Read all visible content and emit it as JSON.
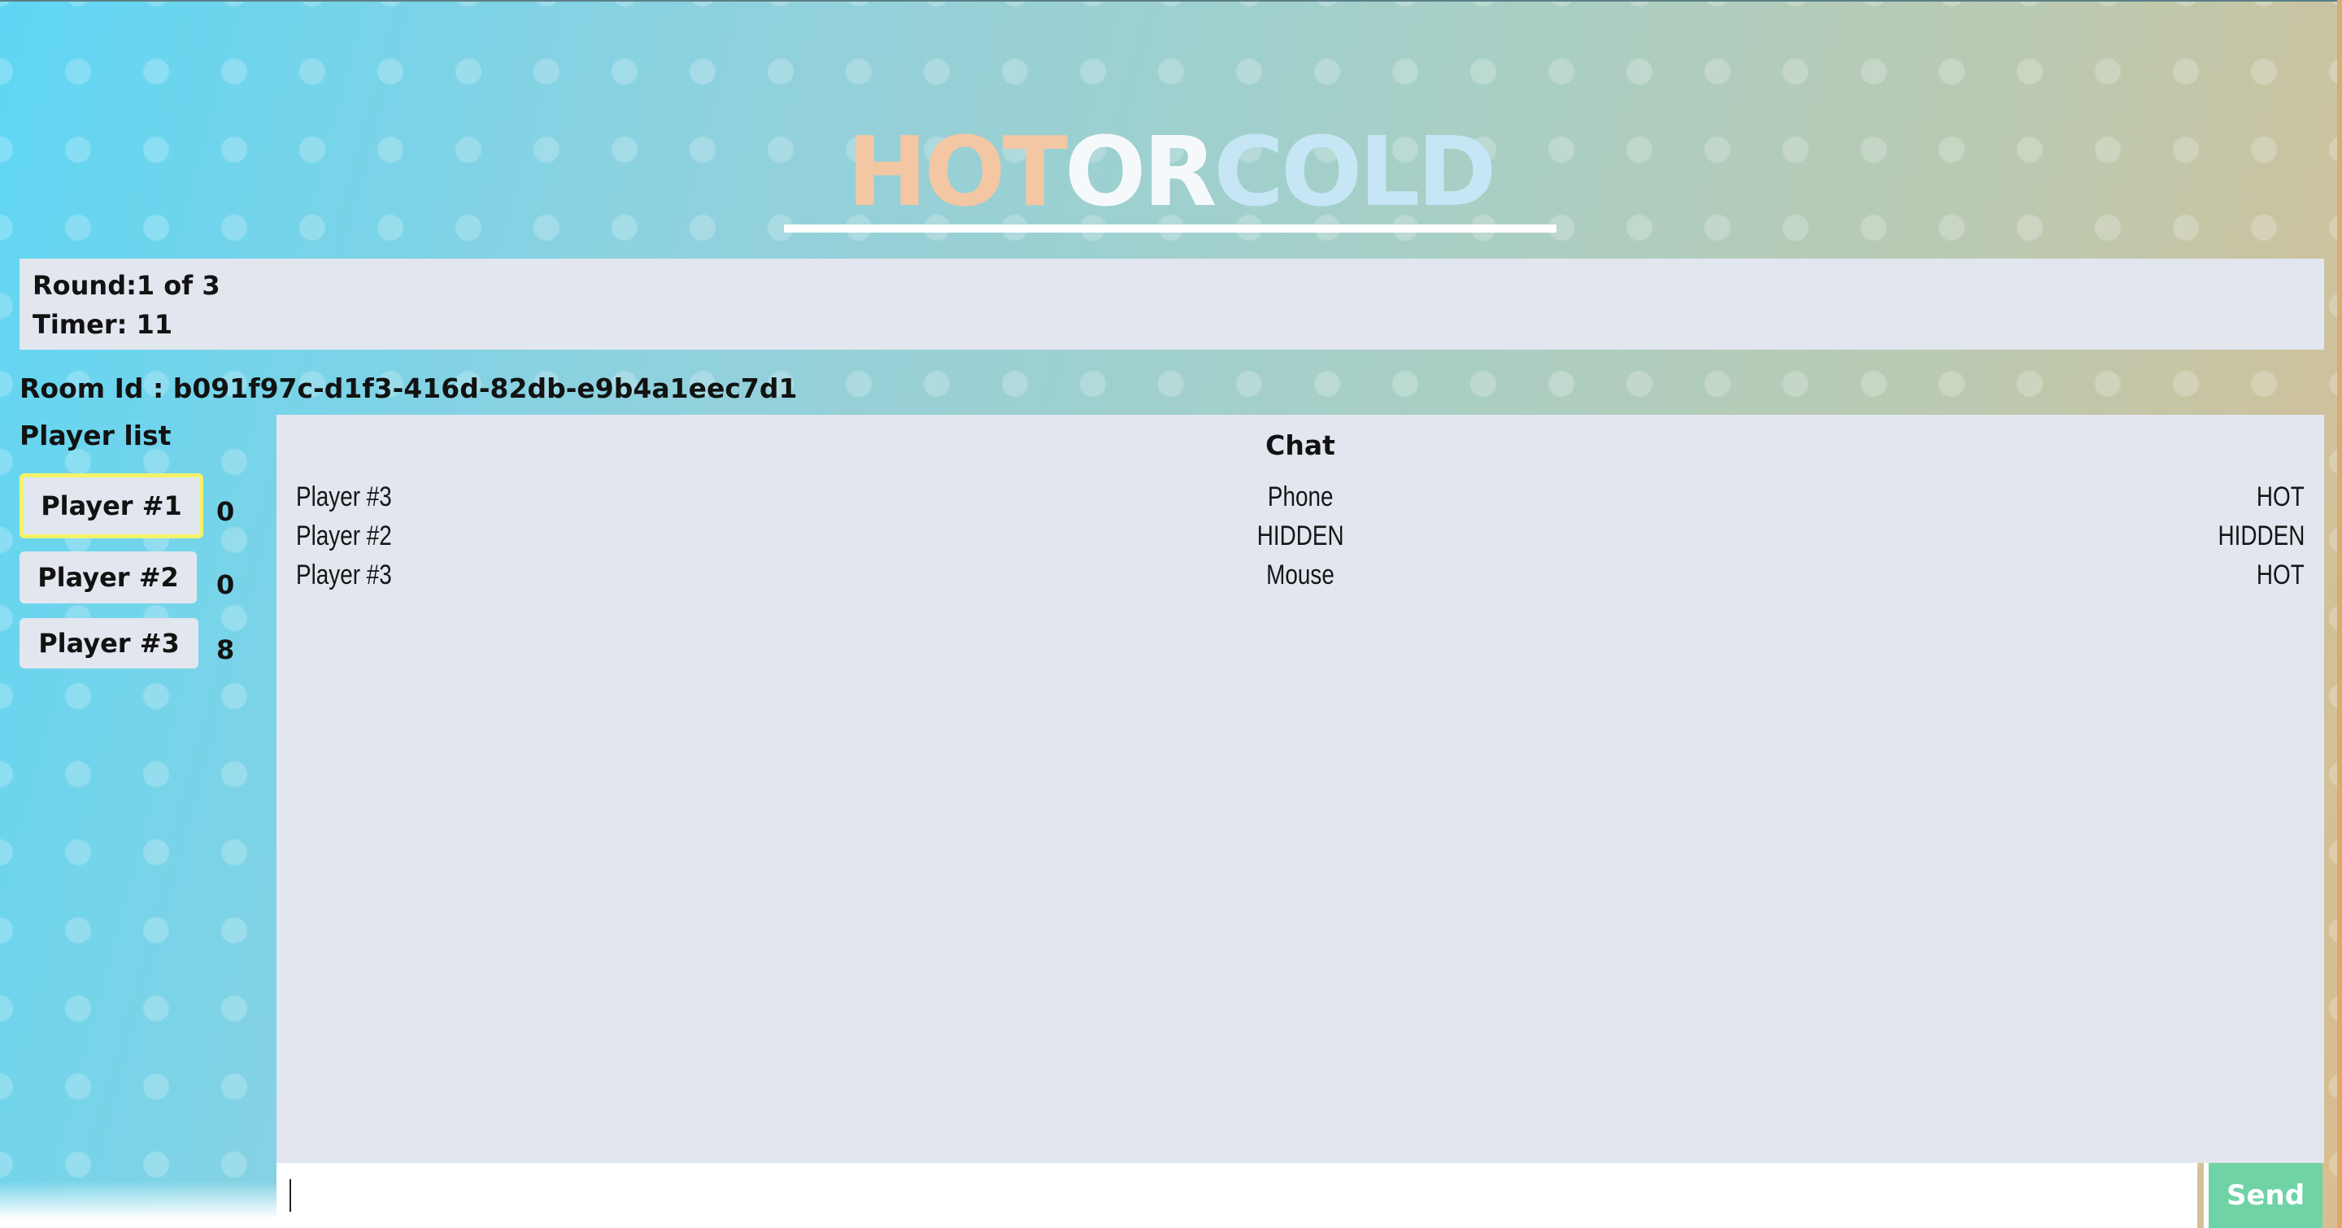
{
  "logo": {
    "hot": "HOT",
    "or": "OR",
    "cold": "COLD"
  },
  "status": {
    "round": "Round:1 of 3",
    "timer": "Timer: 11"
  },
  "room": {
    "label": "Room Id : b091f97c-d1f3-416d-82db-e9b4a1eec7d1"
  },
  "players": {
    "title": "Player list",
    "items": [
      {
        "name": "Player #1",
        "score": "0",
        "active": true
      },
      {
        "name": "Player #2",
        "score": "0",
        "active": false
      },
      {
        "name": "Player #3",
        "score": "8",
        "active": false
      }
    ]
  },
  "chat": {
    "title": "Chat",
    "messages": [
      {
        "user": "Player #3",
        "text": "Phone",
        "status": "HOT"
      },
      {
        "user": "Player #2",
        "text": "HIDDEN",
        "status": "HIDDEN"
      },
      {
        "user": "Player #3",
        "text": "Mouse",
        "status": "HOT"
      }
    ],
    "input_value": "",
    "input_placeholder": "",
    "send_label": "Send"
  },
  "colors": {
    "hot": "#f3c6a4",
    "cold": "#c6e6f6",
    "send": "#6fd3a6",
    "active_player_border": "#f3f36a",
    "panel": "#e2e6ef"
  }
}
